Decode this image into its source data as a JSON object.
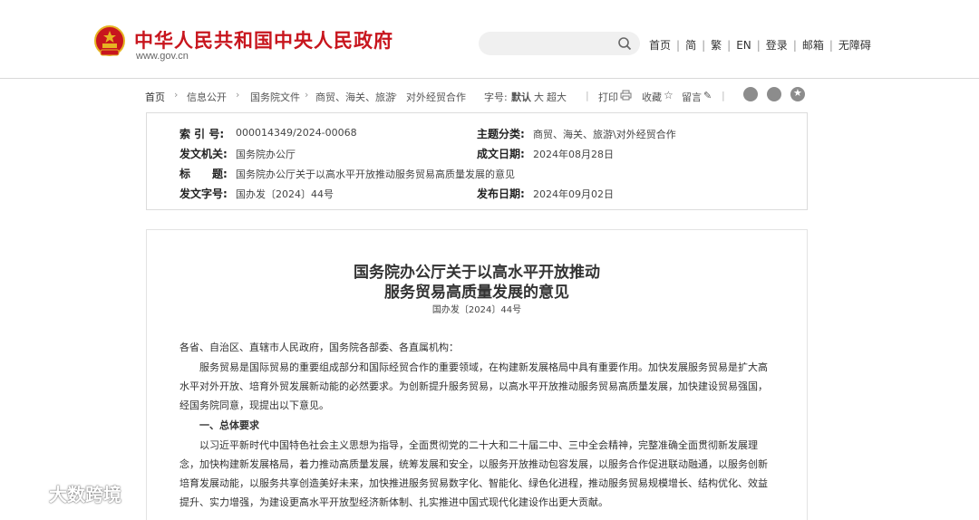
{
  "header": {
    "site_name": "中华人民共和国中央人民政府",
    "site_url": "www.gov.cn",
    "links": [
      "首页",
      "简",
      "繁",
      "EN",
      "登录",
      "邮箱",
      "无障碍"
    ]
  },
  "breadcrumb": {
    "items": [
      "首页",
      "信息公开",
      "国务院文件",
      "商贸、海关、旅游",
      "对外经贸合作"
    ]
  },
  "tools": {
    "font_label": "字号:",
    "font_default": "默认",
    "font_large": "大",
    "font_xlarge": "超大",
    "print": "打印",
    "favorite": "收藏",
    "comment": "留言"
  },
  "meta": {
    "index_label": "索 引 号:",
    "index_value": "000014349/2024-00068",
    "topic_label": "主题分类:",
    "topic_value": "商贸、海关、旅游\\对外经贸合作",
    "issuer_label": "发文机关:",
    "issuer_value": "国务院办公厅",
    "written_label": "成文日期:",
    "written_value": "2024年08月28日",
    "title_label": "标　　题:",
    "title_value": "国务院办公厅关于以高水平开放推动服务贸易高质量发展的意见",
    "docno_label": "发文字号:",
    "docno_value": "国办发〔2024〕44号",
    "published_label": "发布日期:",
    "published_value": "2024年09月02日"
  },
  "article": {
    "title_line1": "国务院办公厅关于以高水平开放推动",
    "title_line2": "服务贸易高质量发展的意见",
    "doc_number": "国办发〔2024〕44号",
    "salutation": "各省、自治区、直辖市人民政府，国务院各部委、各直属机构：",
    "para1_line1": "服务贸易是国际贸易的重要组成部分和国际经贸合作的重要领域，在构建新发展格局中具有重要作用。加快发展服务贸易是扩大高",
    "para1_line2": "水平对外开放、培育外贸发展新动能的必然要求。为创新提升服务贸易，以高水平开放推动服务贸易高质量发展，加快建设贸易强国，",
    "para1_line3": "经国务院同意，现提出以下意见。",
    "section1": "一、总体要求",
    "para2_line1": "以习近平新时代中国特色社会主义思想为指导，全面贯彻党的二十大和二十届二中、三中全会精神，完整准确全面贯彻新发展理",
    "para2_line2": "念，加快构建新发展格局，着力推动高质量发展，统筹发展和安全，以服务开放推动包容发展，以服务合作促进联动融通，以服务创新",
    "para2_line3": "培育发展动能，以服务共享创造美好未来，加快推进服务贸易数字化、智能化、绿色化进程，推动服务贸易规模增长、结构优化、效益",
    "para2_line4": "提升、实力增强，为建设更高水平开放型经济新体制、扎实推进中国式现代化建设作出更大贡献。"
  },
  "watermark": {
    "text": "大数跨境"
  },
  "colors": {
    "brand_red": "#c8161e",
    "emblem_gold": "#e6b422"
  }
}
